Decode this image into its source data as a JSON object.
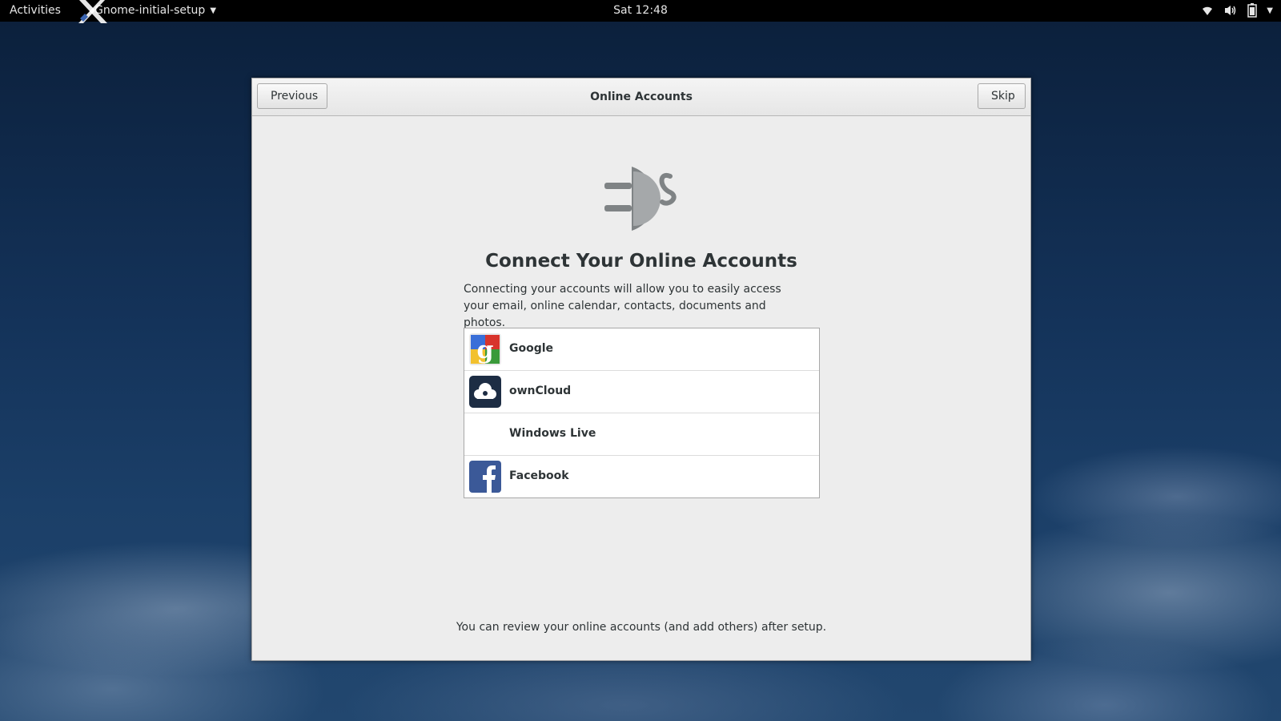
{
  "topbar": {
    "activities": "Activities",
    "app_name": "Gnome-initial-setup",
    "clock": "Sat 12:48",
    "tray_icons": [
      "wifi-icon",
      "volume-icon",
      "battery-icon",
      "system-menu-caret-icon"
    ]
  },
  "dialog": {
    "title": "Online Accounts",
    "previous_label": "Previous",
    "skip_label": "Skip",
    "heading": "Connect Your Online Accounts",
    "description": "Connecting your accounts will allow you to easily access your email, online calendar, contacts, documents and photos.",
    "providers": [
      {
        "label": "Google",
        "icon": "google-icon"
      },
      {
        "label": "ownCloud",
        "icon": "owncloud-icon"
      },
      {
        "label": "Windows Live",
        "icon": "none"
      },
      {
        "label": "Facebook",
        "icon": "facebook-icon"
      }
    ],
    "footer_note": "You can review your online accounts (and add others) after setup."
  },
  "colors": {
    "topbar_bg": "#000000",
    "dialog_bg": "#ededed",
    "text": "#2e3436",
    "google_blue": "#3a6fd8",
    "google_red": "#d8342c",
    "google_yellow": "#f2c12e",
    "google_green": "#3a9a3a",
    "owncloud": "#1d2d44",
    "facebook": "#3b5998"
  }
}
